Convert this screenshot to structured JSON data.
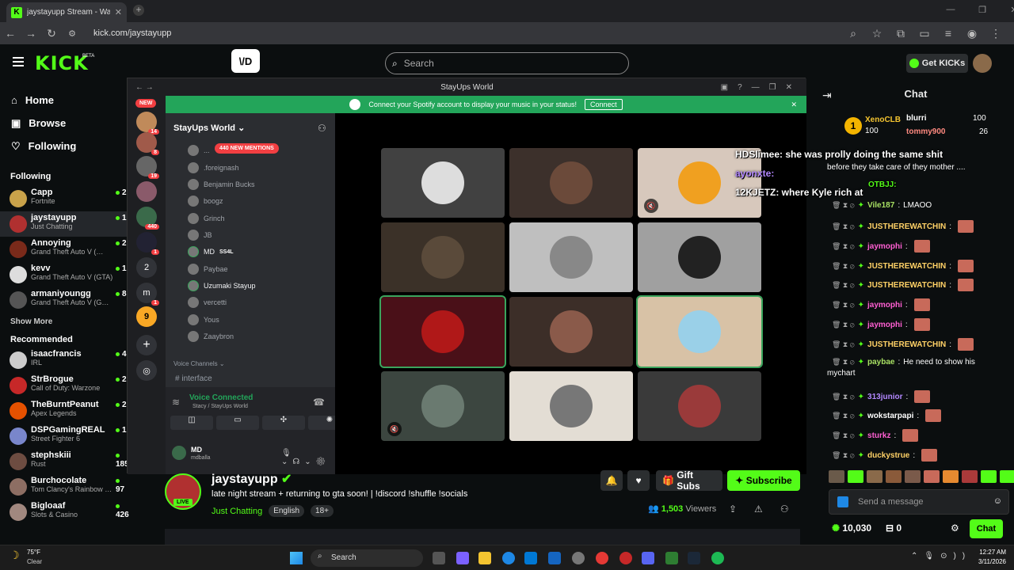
{
  "browser": {
    "tab_title": "jaystayupp Stream - Watch Live",
    "url": "kick.com/jaystayupp"
  },
  "header": {
    "logo": "KICK",
    "beta": "BETA",
    "search_placeholder": "Search",
    "get_kicks": "Get KICKs"
  },
  "nav": [
    "Home",
    "Browse",
    "Following"
  ],
  "following": {
    "title": "Following",
    "show_more": "Show More",
    "channels": [
      {
        "name": "Capp",
        "game": "Fortnite",
        "viewers": "2"
      },
      {
        "name": "jaystayupp",
        "game": "Just Chatting",
        "viewers": "1"
      },
      {
        "name": "Annoying",
        "game": "Grand Theft Auto V (…",
        "viewers": "2"
      },
      {
        "name": "kevv",
        "game": "Grand Theft Auto V (GTA)",
        "viewers": "1"
      },
      {
        "name": "armaniyoungg",
        "game": "Grand Theft Auto V (G…",
        "viewers": "8"
      }
    ]
  },
  "recommended": {
    "title": "Recommended",
    "channels": [
      {
        "name": "isaacfrancis",
        "game": "IRL",
        "viewers": "4"
      },
      {
        "name": "StrBrogue",
        "game": "Call of Duty: Warzone",
        "viewers": "2"
      },
      {
        "name": "TheBurntPeanut",
        "game": "Apex Legends",
        "viewers": "2"
      },
      {
        "name": "DSPGamingREAL",
        "game": "Street Fighter 6",
        "viewers": "1"
      },
      {
        "name": "stephskiii",
        "game": "Rust",
        "viewers": "185"
      },
      {
        "name": "Burchocolate",
        "game": "Tom Clancy's Rainbow …",
        "viewers": "97"
      },
      {
        "name": "Bigloaaf",
        "game": "Slots & Casino",
        "viewers": "426"
      }
    ]
  },
  "discord": {
    "title": "StayUps World",
    "spotify_msg": "Connect your Spotify account to display your music in your status!",
    "connect": "Connect",
    "new": "NEW",
    "server": "StayUps World",
    "mentions": "440 NEW MENTIONS",
    "members": [
      "...",
      ".foreignash",
      "Benjamin Bucks",
      "boogz",
      "Grinch",
      "JB",
      "MD",
      "Paybae",
      "Uzumaki Stayup",
      "vercetti",
      "Yous",
      "Zaaybron"
    ],
    "md_tag": "SS4L",
    "voice_channels": "Voice Channels",
    "interface": "interface",
    "voice_connected": "Voice Connected",
    "voice_sub": "Stacy / StayUps World",
    "user": "MD",
    "user_tag": "mdballa",
    "server_badges": [
      "14",
      "8",
      "19",
      "440",
      "1",
      "1"
    ],
    "server_letters": [
      "2",
      "m"
    ]
  },
  "stream": {
    "streamer": "jaystayupp",
    "live": "LIVE",
    "title": "late night stream + returning to gta soon! | !discord !shuffle !socials",
    "category": "Just Chatting",
    "tags": [
      "English",
      "18+"
    ],
    "viewers": "1,503",
    "viewers_label": "Viewers",
    "gift_subs": "Gift Subs",
    "subscribe": "Subscribe"
  },
  "chat": {
    "title": "Chat",
    "top": [
      {
        "name": "XenoCLB",
        "amt": "100"
      },
      {
        "name": "blurri",
        "amt": "100"
      },
      {
        "name": "tommy900",
        "amt": "26"
      }
    ],
    "top_amt": "100",
    "overlay": [
      "HDSlimee: she was prolly doing the same shit",
      "ayonxte:",
      "12KJETZ: where Kyle rich at",
      "OTBJJ:"
    ],
    "partial": "before they take care of they mother ....",
    "messages": [
      {
        "u": "Vile187",
        "t": "LMAOO",
        "c": "#a8e063"
      },
      {
        "u": "JUSTHEREWATCHIN",
        "t": "",
        "c": "#ffd166"
      },
      {
        "u": "jaymophi",
        "t": "",
        "c": "#ff5fd2"
      },
      {
        "u": "JUSTHEREWATCHIN",
        "t": "",
        "c": "#ffd166"
      },
      {
        "u": "JUSTHEREWATCHIN",
        "t": "",
        "c": "#ffd166"
      },
      {
        "u": "jaymophi",
        "t": "",
        "c": "#ff5fd2"
      },
      {
        "u": "jaymophi",
        "t": "",
        "c": "#ff5fd2"
      },
      {
        "u": "JUSTHEREWATCHIN",
        "t": "",
        "c": "#ffd166"
      },
      {
        "u": "paybae",
        "t": "He need to show his",
        "c": "#a8e063"
      },
      {
        "u": "313junior",
        "t": "",
        "c": "#b388ff"
      },
      {
        "u": "wokstarpapi",
        "t": "",
        "c": "#ffffff"
      },
      {
        "u": "sturkz",
        "t": "",
        "c": "#ff5fd2"
      },
      {
        "u": "duckystrue",
        "t": "",
        "c": "#ffd166"
      }
    ],
    "wrap": "mychart",
    "input_placeholder": "Send a message",
    "points": "10,030",
    "chests": "0",
    "chat_btn": "Chat"
  },
  "taskbar": {
    "temp": "75°F",
    "weather": "Clear",
    "search": "Search",
    "time": "12:27 AM",
    "date": "3/11/2026"
  }
}
